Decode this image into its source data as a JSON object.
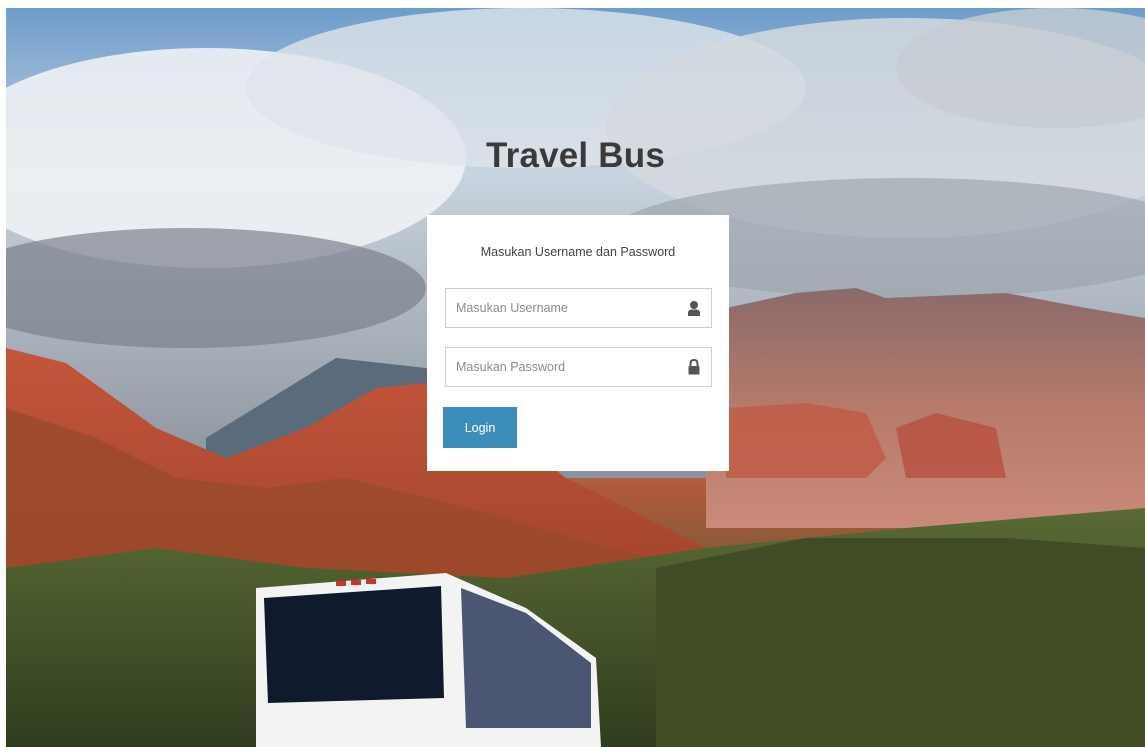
{
  "app": {
    "title": "Travel Bus"
  },
  "login": {
    "message": "Masukan Username dan Password",
    "username_placeholder": "Masukan Username",
    "username_icon": "user-icon",
    "password_placeholder": "Masukan Password",
    "password_icon": "lock-icon",
    "button_label": "Login",
    "button_color": "#3c8dbc"
  }
}
